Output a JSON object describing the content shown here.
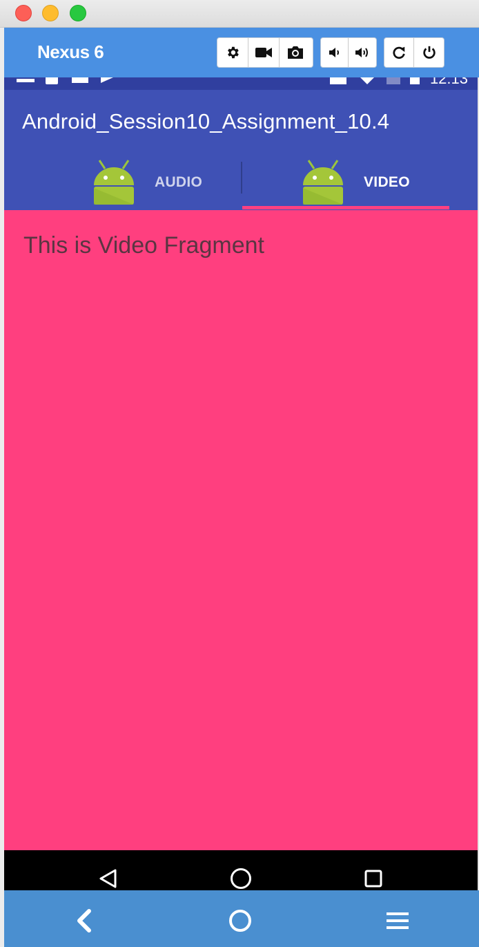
{
  "window": {
    "device_name": "Nexus 6"
  },
  "toolbar": {
    "buttons": [
      {
        "icon": "gear-icon"
      },
      {
        "icon": "video-camera-icon"
      },
      {
        "icon": "camera-icon"
      },
      {
        "icon": "volume-down-icon"
      },
      {
        "icon": "volume-up-icon"
      },
      {
        "icon": "rotate-icon"
      },
      {
        "icon": "power-icon"
      }
    ]
  },
  "status_bar": {
    "time": "12:13"
  },
  "app": {
    "title": "Android_Session10_Assignment_10.4",
    "tabs": [
      {
        "label": "AUDIO",
        "icon": "android-icon",
        "selected": false
      },
      {
        "label": "VIDEO",
        "icon": "android-icon",
        "selected": true
      }
    ],
    "content_text": "This is Video Fragment",
    "colors": {
      "status_bar": "#303f9f",
      "app_bar": "#3f51b5",
      "content_bg": "#ff3f7f",
      "accent": "#ff4081"
    }
  },
  "android_nav": {
    "buttons": [
      "back-triangle-icon",
      "home-circle-icon",
      "recents-square-icon"
    ]
  },
  "emulator_nav": {
    "buttons": [
      "back-chevron-icon",
      "home-circle-icon",
      "menu-icon"
    ]
  }
}
